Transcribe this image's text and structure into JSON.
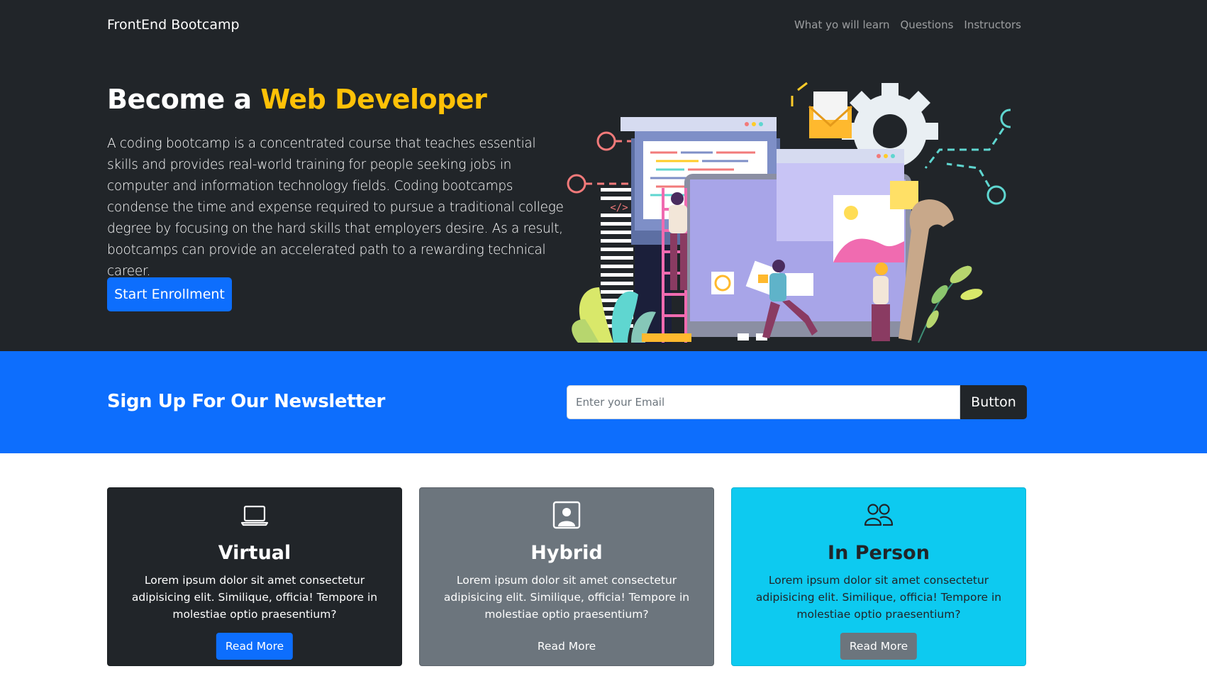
{
  "nav": {
    "brand": "FrontEnd Bootcamp",
    "links": [
      "What yo will learn",
      "Questions",
      "Instructors"
    ]
  },
  "hero": {
    "title_prefix": "Become a",
    "title_accent": "Web Developer",
    "description": "A coding bootcamp is a concentrated course that teaches essential skills and provides real-world training for people seeking jobs in computer and information technology fields. Coding bootcamps condense the time and expense required to pursue a traditional college degree by focusing on the hard skills that employers desire. As a result, bootcamps can provide an accelerated path to a rewarding technical career.",
    "button_label": "Start Enrollment",
    "illustration_code_tag": "</>"
  },
  "newsletter": {
    "title": "Sign Up For Our Newsletter",
    "email_placeholder": "Enter your Email",
    "email_value": "",
    "button_label": "Button"
  },
  "boxes": [
    {
      "icon": "laptop-icon",
      "title": "Virtual",
      "text": "Lorem ipsum dolor sit amet consectetur adipisicing elit. Similique, officia! Tempore in molestiae optio praesentium?",
      "button_label": "Read More"
    },
    {
      "icon": "person-square-icon",
      "title": "Hybrid",
      "text": "Lorem ipsum dolor sit amet consectetur adipisicing elit. Similique, officia! Tempore in molestiae optio praesentium?",
      "button_label": "Read More"
    },
    {
      "icon": "people-icon",
      "title": "In Person",
      "text": "Lorem ipsum dolor sit amet consectetur adipisicing elit. Similique, officia! Tempore in molestiae optio praesentium?",
      "button_label": "Read More"
    }
  ],
  "colors": {
    "dark": "#212529",
    "primary": "#0d6efd",
    "warning": "#ffc107",
    "secondary": "#6c757d",
    "info": "#0dcaf0"
  }
}
